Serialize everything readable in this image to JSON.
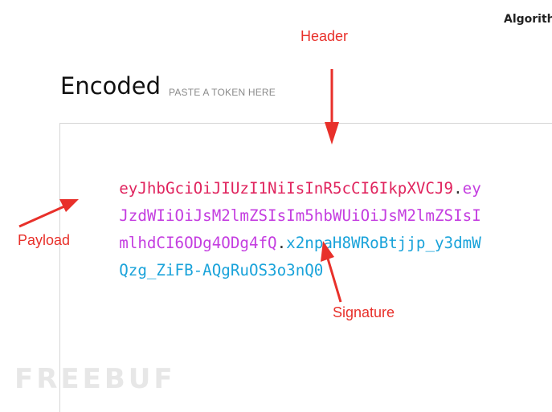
{
  "header_right": {
    "algorithm_label": "Algorithm"
  },
  "encoded_section": {
    "title": "Encoded",
    "hint": "PASTE A TOKEN HERE"
  },
  "token": {
    "lines": [
      {
        "segments": [
          {
            "part": "header",
            "text": "eyJhbGciOiJIUzI1NiIsInR5cCI6IkpXVCJ9"
          },
          {
            "part": "dot",
            "text": "."
          },
          {
            "part": "payload",
            "text": "ey"
          }
        ]
      },
      {
        "segments": [
          {
            "part": "payload",
            "text": "JzdWIiOiJsM2lmZSIsIm5hbWUiOiJsM2lmZSIsI"
          }
        ]
      },
      {
        "segments": [
          {
            "part": "payload",
            "text": "mlhdCI6ODg4ODg4fQ"
          },
          {
            "part": "dot",
            "text": "."
          },
          {
            "part": "signature",
            "text": "x2npaH8WRoBtjjp_y3dmW"
          }
        ]
      },
      {
        "segments": [
          {
            "part": "signature",
            "text": "Qzg_ZiFB-AQgRuOS3o3nQ0"
          }
        ]
      }
    ],
    "colors": {
      "header": "#e0245e",
      "payload": "#c43ee0",
      "signature": "#1aa3da",
      "dot": "#333333"
    }
  },
  "annotations": {
    "header": "Header",
    "payload": "Payload",
    "signature": "Signature",
    "color": "#e8302a"
  },
  "watermark": {
    "text": "FREEBUF"
  }
}
